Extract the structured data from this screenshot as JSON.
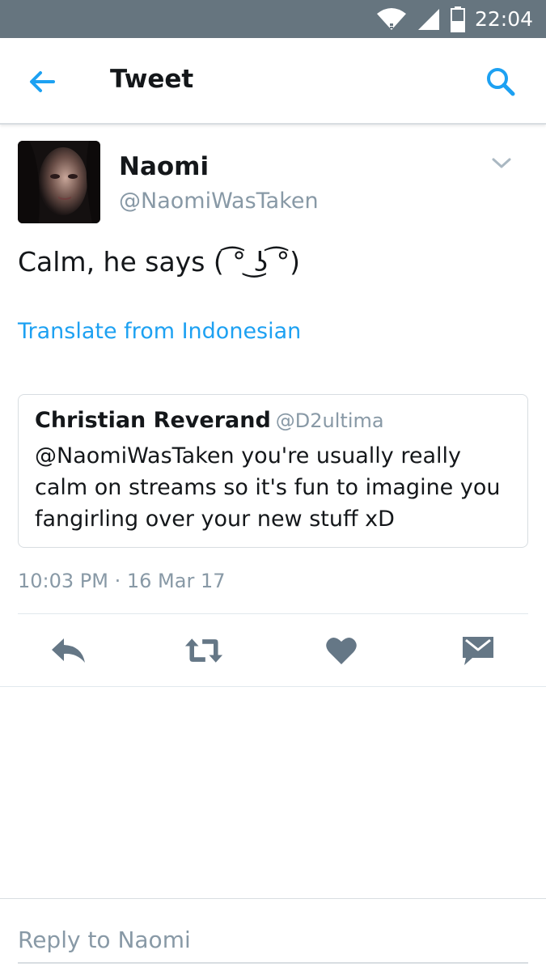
{
  "status_bar": {
    "time": "22:04",
    "icons": [
      "wifi-icon",
      "signal-icon",
      "battery-icon"
    ]
  },
  "app_bar": {
    "title": "Tweet",
    "back_icon": "arrow-left-icon",
    "search_icon": "search-icon"
  },
  "tweet": {
    "author_name": "Naomi",
    "author_handle": "@NaomiWasTaken",
    "text": "Calm, he says ( ͡° ͜ʖ ͡°)",
    "translate_label": "Translate from Indonesian",
    "timestamp": "10:03 PM · 16 Mar 17"
  },
  "quoted_tweet": {
    "author_name": "Christian Reverand",
    "author_handle": "@D2ultima",
    "text": "@NaomiWasTaken you're usually really calm on streams so it's fun to imagine you fangirling over your new stuff xD"
  },
  "actions": [
    "reply-icon",
    "retweet-icon",
    "like-icon",
    "direct-message-icon"
  ],
  "reply": {
    "placeholder": "Reply to Naomi"
  },
  "colors": {
    "status_bar": "#66757f",
    "accent": "#1da1f2",
    "muted": "#8899a6",
    "action_icon": "#657786"
  }
}
